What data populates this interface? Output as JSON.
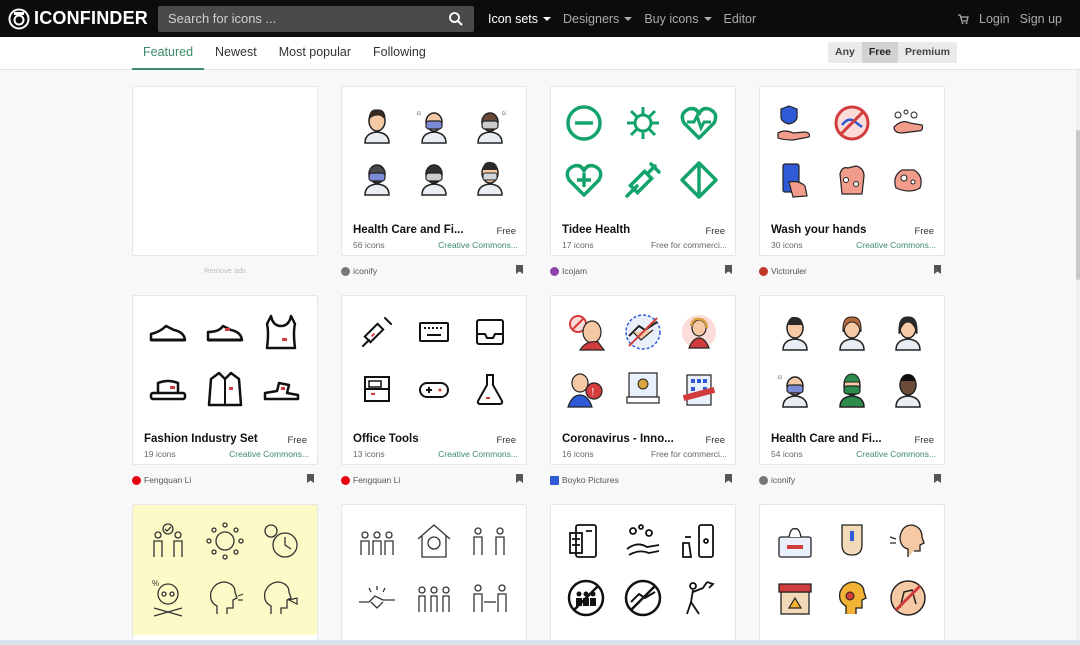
{
  "brand": {
    "name": "ICONFINDER"
  },
  "search": {
    "placeholder": "Search for icons ..."
  },
  "nav": {
    "links": [
      {
        "label": "Icon sets",
        "active": true
      },
      {
        "label": "Designers",
        "active": false
      },
      {
        "label": "Buy icons",
        "active": false
      },
      {
        "label": "Editor",
        "active": false
      }
    ],
    "login": "Login",
    "signup": "Sign up"
  },
  "tabs": [
    "Featured",
    "Newest",
    "Most popular",
    "Following"
  ],
  "price_filter": [
    "Any",
    "Free",
    "Premium"
  ],
  "ad": {
    "remove_label": "Remove ads"
  },
  "cards": [
    {
      "title": "Health Care and Fi...",
      "price": "Free",
      "count": "56 icons",
      "license": "Creative Commons...",
      "author": "iconify"
    },
    {
      "title": "Tidee Health",
      "price": "Free",
      "count": "17 icons",
      "license": "Free for commerci...",
      "author": "Icojam"
    },
    {
      "title": "Wash your hands",
      "price": "Free",
      "count": "30 icons",
      "license": "Creative Commons...",
      "author": "Victoruler"
    },
    {
      "title": "Fashion Industry Set",
      "price": "Free",
      "count": "19 icons",
      "license": "Creative Commons...",
      "author": "Fengquan Li"
    },
    {
      "title": "Office Tools",
      "price": "Free",
      "count": "13 icons",
      "license": "Creative Commons...",
      "author": "Fengquan Li"
    },
    {
      "title": "Coronavirus - Inno...",
      "price": "Free",
      "count": "16 icons",
      "license": "Free for commerci...",
      "author": "Boyko Pictures"
    },
    {
      "title": "Health Care and Fi...",
      "price": "Free",
      "count": "54 icons",
      "license": "Creative Commons...",
      "author": "iconify"
    }
  ],
  "colors": {
    "accent": "#3b8a68",
    "tidee_green": "#13a36b",
    "nav_bg": "#0c0c0c"
  }
}
